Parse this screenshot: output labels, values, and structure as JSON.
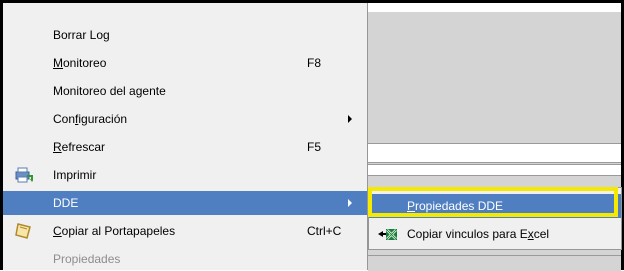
{
  "menu": {
    "items": [
      {
        "label": "Borrar Log",
        "shortcut": "",
        "has_submenu": false,
        "state": "normal"
      },
      {
        "label": "Monitoreo",
        "shortcut": "F8",
        "has_submenu": false,
        "state": "normal"
      },
      {
        "label": "Monitoreo del agente",
        "shortcut": "",
        "has_submenu": false,
        "state": "normal"
      },
      {
        "label": "Configuración",
        "shortcut": "",
        "has_submenu": true,
        "state": "normal"
      },
      {
        "label": "Refrescar",
        "shortcut": "F5",
        "has_submenu": false,
        "state": "normal"
      },
      {
        "label": "Imprimir",
        "shortcut": "",
        "has_submenu": false,
        "state": "normal",
        "icon": "printer-icon"
      },
      {
        "label": "DDE",
        "shortcut": "",
        "has_submenu": true,
        "state": "selected"
      },
      {
        "label": "Copiar al Portapapeles",
        "shortcut": "Ctrl+C",
        "has_submenu": false,
        "state": "normal",
        "icon": "clipboard-icon"
      },
      {
        "label": "Propiedades",
        "shortcut": "",
        "has_submenu": false,
        "state": "disabled"
      }
    ]
  },
  "submenu": {
    "items": [
      {
        "label": "Propiedades DDE",
        "state": "selected"
      },
      {
        "label": "Copiar vinculos para Excel",
        "state": "normal",
        "icon": "excel-link-icon"
      }
    ]
  },
  "colors": {
    "selection": "#4f7fc0",
    "highlight_box": "#f5e900",
    "menu_bg": "#f0f0f0",
    "disabled_text": "#8d8d8d"
  }
}
